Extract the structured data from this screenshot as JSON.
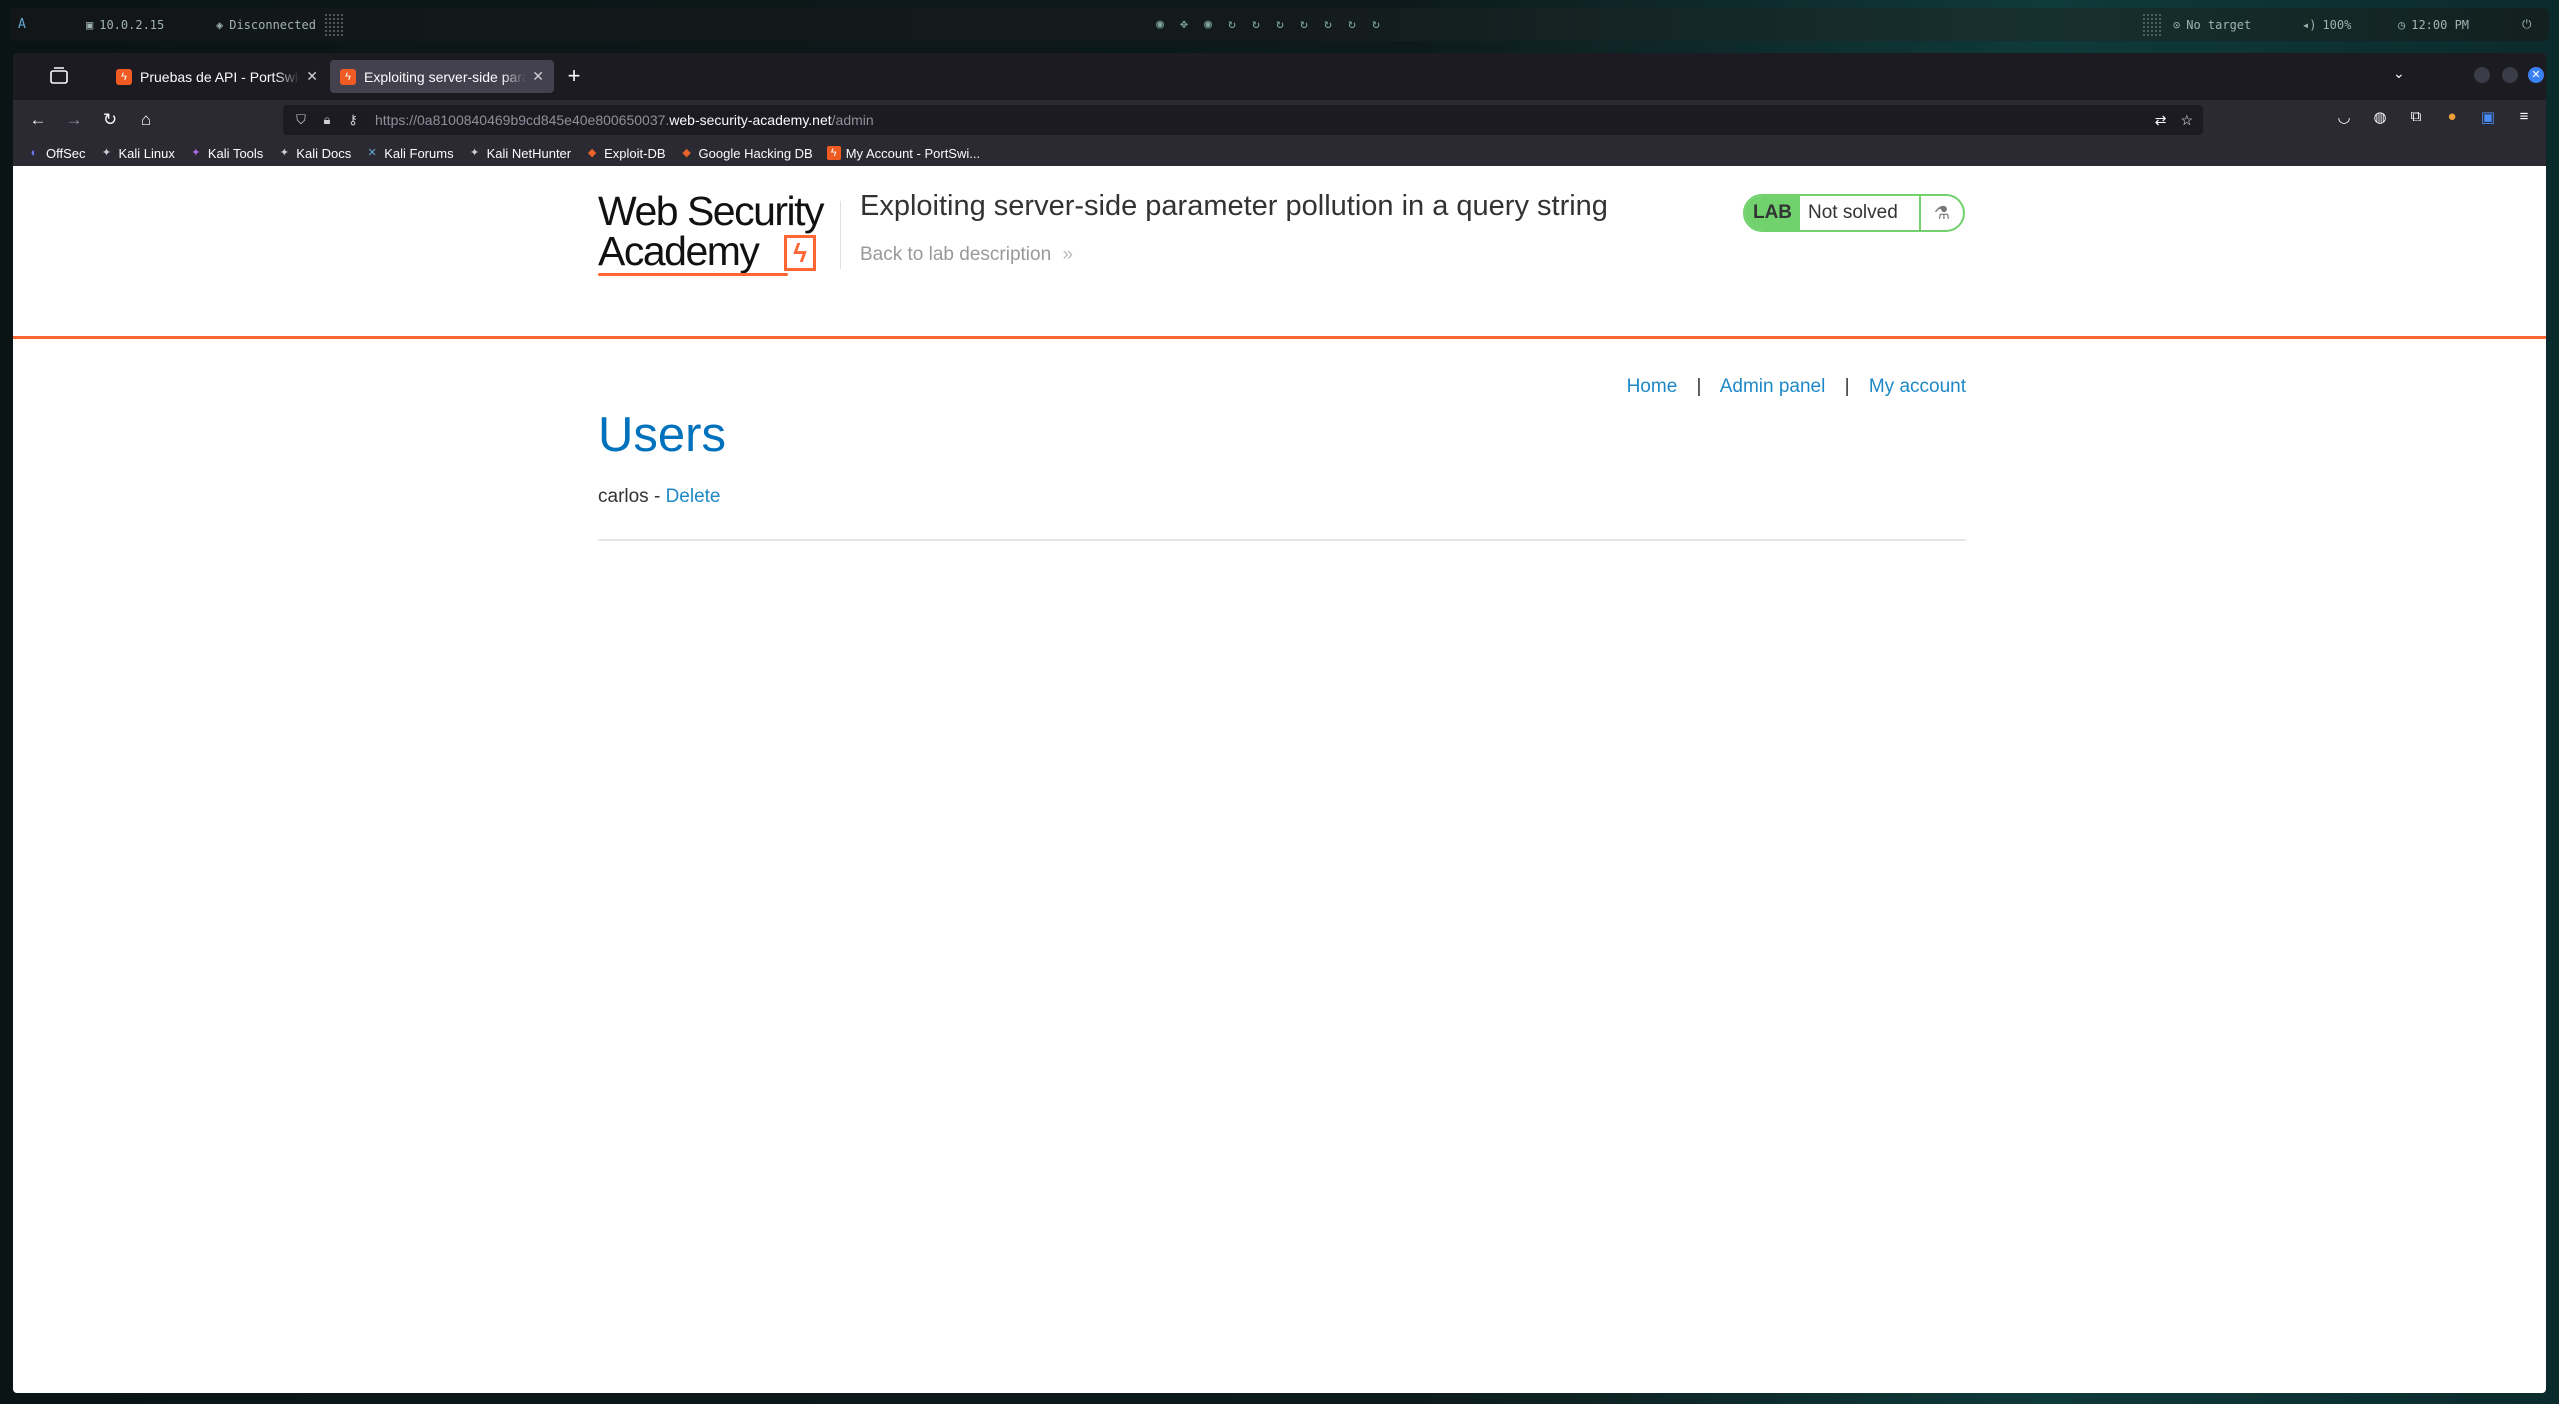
{
  "desktop": {
    "ip": "10.0.2.15",
    "vpn_status": "Disconnected",
    "target": "No target",
    "volume": "100%",
    "clock": "12:00 PM"
  },
  "browser": {
    "tabs": [
      {
        "title": "Pruebas de API - PortSwigger",
        "active": false
      },
      {
        "title": "Exploiting server-side parameter pollution in a query string",
        "active": true
      }
    ],
    "url": {
      "prefix": "https://0a8100840469b9cd845e40e800650037.",
      "domain": "web-security-academy.net",
      "path": "/admin"
    },
    "bookmarks": [
      "OffSec",
      "Kali Linux",
      "Kali Tools",
      "Kali Docs",
      "Kali Forums",
      "Kali NetHunter",
      "Exploit-DB",
      "Google Hacking DB",
      "My Account - PortSwi..."
    ]
  },
  "lab": {
    "logo_line1": "Web Security",
    "logo_line2": "Academy",
    "title": "Exploiting server-side parameter pollution in a query string",
    "back_link": "Back to lab description",
    "badge": "LAB",
    "status": "Not solved"
  },
  "nav": {
    "home": "Home",
    "admin_panel": "Admin panel",
    "my_account": "My account",
    "separator": "|"
  },
  "content": {
    "heading": "Users",
    "user": "carlos",
    "dash": " - ",
    "delete": "Delete"
  },
  "colors": {
    "accent": "#ff6633",
    "link": "#1e88c7",
    "heading": "#0071bc",
    "lab_green": "#70d16d"
  }
}
